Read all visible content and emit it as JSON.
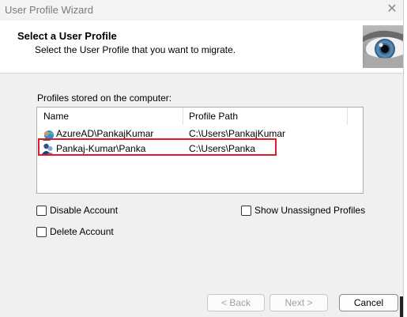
{
  "window": {
    "title": "User Profile Wizard",
    "close_glyph": "✕"
  },
  "header": {
    "title": "Select a User Profile",
    "subtitle": "Select the User Profile that you want to migrate.",
    "graphic": "eye-graphic"
  },
  "profiles": {
    "group_label": "Profiles stored on the computer:",
    "columns": [
      "Name",
      "Profile Path"
    ],
    "rows": [
      {
        "name": "AzureAD\\PankajKumar",
        "path": "C:\\Users\\PankajKumar",
        "icon": "azure-user-icon"
      },
      {
        "name": "Pankaj-Kumar\\Panka",
        "path": "C:\\Users\\Panka",
        "icon": "local-user-icon",
        "highlighted": true
      }
    ]
  },
  "options": {
    "disable_account": "Disable Account",
    "delete_account": "Delete Account",
    "show_unassigned": "Show Unassigned Profiles"
  },
  "buttons": {
    "back": "< Back",
    "next": "Next >",
    "cancel": "Cancel"
  },
  "colors": {
    "highlight_border": "#e01a2b",
    "window_bg": "#f0f0f0"
  }
}
